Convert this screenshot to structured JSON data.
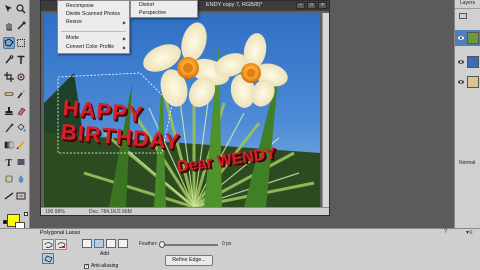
{
  "document": {
    "title_fragment": "ENDY copy 7, RGB/8)*",
    "zoom": "100 99%",
    "doc_info": "Doc: 784.1K/2.66M"
  },
  "menu": {
    "items": [
      {
        "label": "Recompose"
      },
      {
        "label": "Divide Scanned Photos"
      },
      {
        "label": "Resize"
      },
      {
        "label": "Mode"
      },
      {
        "label": "Convert Color Profile"
      }
    ],
    "submenu": [
      {
        "label": "Distort"
      },
      {
        "label": "Perspective"
      }
    ]
  },
  "canvas_text": {
    "line1": "HAPPY",
    "line2": "BIRTHDAY",
    "line3": "Dear WENDY"
  },
  "right_panel": {
    "layers_label": "Layers",
    "blend_mode": "Normal"
  },
  "options": {
    "tool_name": "Polygonal Lasso",
    "add_label": "Add",
    "feather_label": "Feather:",
    "feather_value": "0 px",
    "refine_edge": "Refine Edge...",
    "anti_alias": "Anti-aliasing",
    "feather_level": 0
  },
  "colors": {
    "foreground": "#ffff00",
    "background": "#ffffff",
    "text_red": "#d8202a",
    "selected_layer": "#4f7fb6"
  }
}
